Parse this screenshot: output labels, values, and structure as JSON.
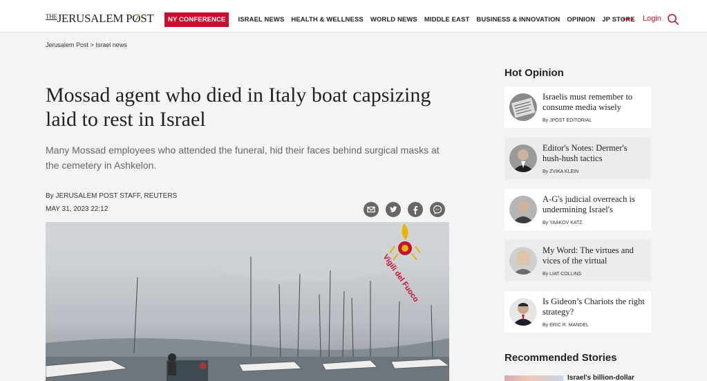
{
  "header": {
    "logo_the": "THE",
    "logo_text": "JERUSALEM POST",
    "nav": [
      {
        "label": "NY CONFERENCE",
        "highlight": true
      },
      {
        "label": "ISRAEL NEWS"
      },
      {
        "label": "HEALTH & WELLNESS"
      },
      {
        "label": "WORLD NEWS"
      },
      {
        "label": "MIDDLE EAST"
      },
      {
        "label": "BUSINESS & INNOVATION"
      },
      {
        "label": "OPINION"
      },
      {
        "label": "JP STORE"
      }
    ],
    "more_label": "•••",
    "login_label": "Login",
    "search_icon": "search-icon",
    "accent_color": "#c8102e"
  },
  "breadcrumb": {
    "home": "Jerusalem Post",
    "separator": " > ",
    "section": "Israel news"
  },
  "article": {
    "headline": "Mossad agent who died in Italy boat capsizing laid to rest in Israel",
    "subhead": "Many Mossad employees who attended the funeral, hid their faces behind surgical masks at the cemetery in Ashkelon.",
    "byline": "By JERUSALEM POST STAFF, REUTERS",
    "date": "MAY 31, 2023 22:12",
    "share_icons": [
      "email-icon",
      "twitter-icon",
      "facebook-icon",
      "messenger-icon"
    ],
    "image_watermark": "Vigili del Fuoco"
  },
  "sidebar": {
    "hot_opinion_title": "Hot Opinion",
    "opinions": [
      {
        "title": "Israelis must remember to consume media wisely",
        "by": "By",
        "author": "JPOST EDITORIAL"
      },
      {
        "title": "Editor's Notes: Dermer's hush-hush tactics",
        "by": "By",
        "author": "ZVIKA KLEIN"
      },
      {
        "title": "A-G's judicial overreach is undermining Israel's",
        "by": "By",
        "author": "YAAKOV KATZ"
      },
      {
        "title": "My Word: The virtues and vices of the virtual",
        "by": "By",
        "author": "LIAT COLLINS"
      },
      {
        "title": "Is Gideon’s Chariots the right strategy?",
        "by": "By",
        "author": "ERIC R. MANDEL"
      }
    ],
    "recommended_title": "Recommended Stories",
    "recommended": [
      {
        "title": "Israel's billion-dollar"
      }
    ]
  }
}
